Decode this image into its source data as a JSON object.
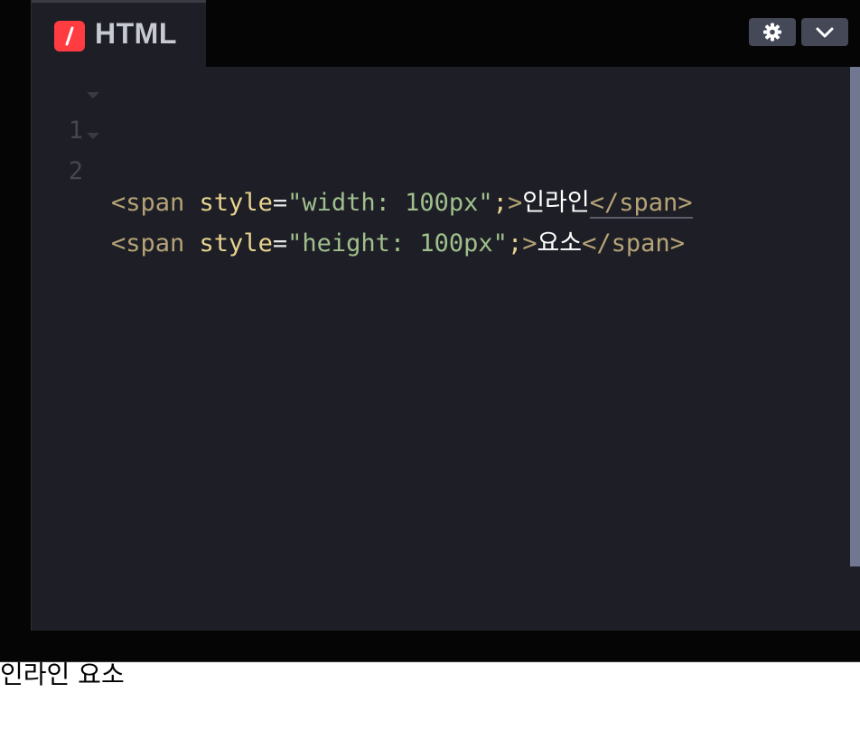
{
  "tab": {
    "title": "HTML",
    "icon": "codepen-html-icon",
    "icon_color": "#ff3c41"
  },
  "toolbar": {
    "settings_icon": "gear-icon",
    "collapse_icon": "chevron-down-icon"
  },
  "editor": {
    "lines": [
      {
        "number": "1",
        "open_tag": "<span",
        "attr": "style",
        "eq": "=",
        "value": "\"width: 100px\"",
        "semi": ";",
        "close_open": ">",
        "text": "인라인",
        "end_tag": "</span>"
      },
      {
        "number": "2",
        "open_tag": "<span",
        "attr": "style",
        "eq": "=",
        "value": "\"height: 100px\"",
        "semi": ";",
        "close_open": ">",
        "text": "요소",
        "end_tag": "</span>"
      }
    ]
  },
  "preview": {
    "text": "인라인 요소"
  },
  "colors": {
    "editor_bg": "#1e1f26",
    "tag": "#b5a276",
    "attribute": "#e8d390",
    "string": "#a0bf8c",
    "text": "#ffffff"
  }
}
